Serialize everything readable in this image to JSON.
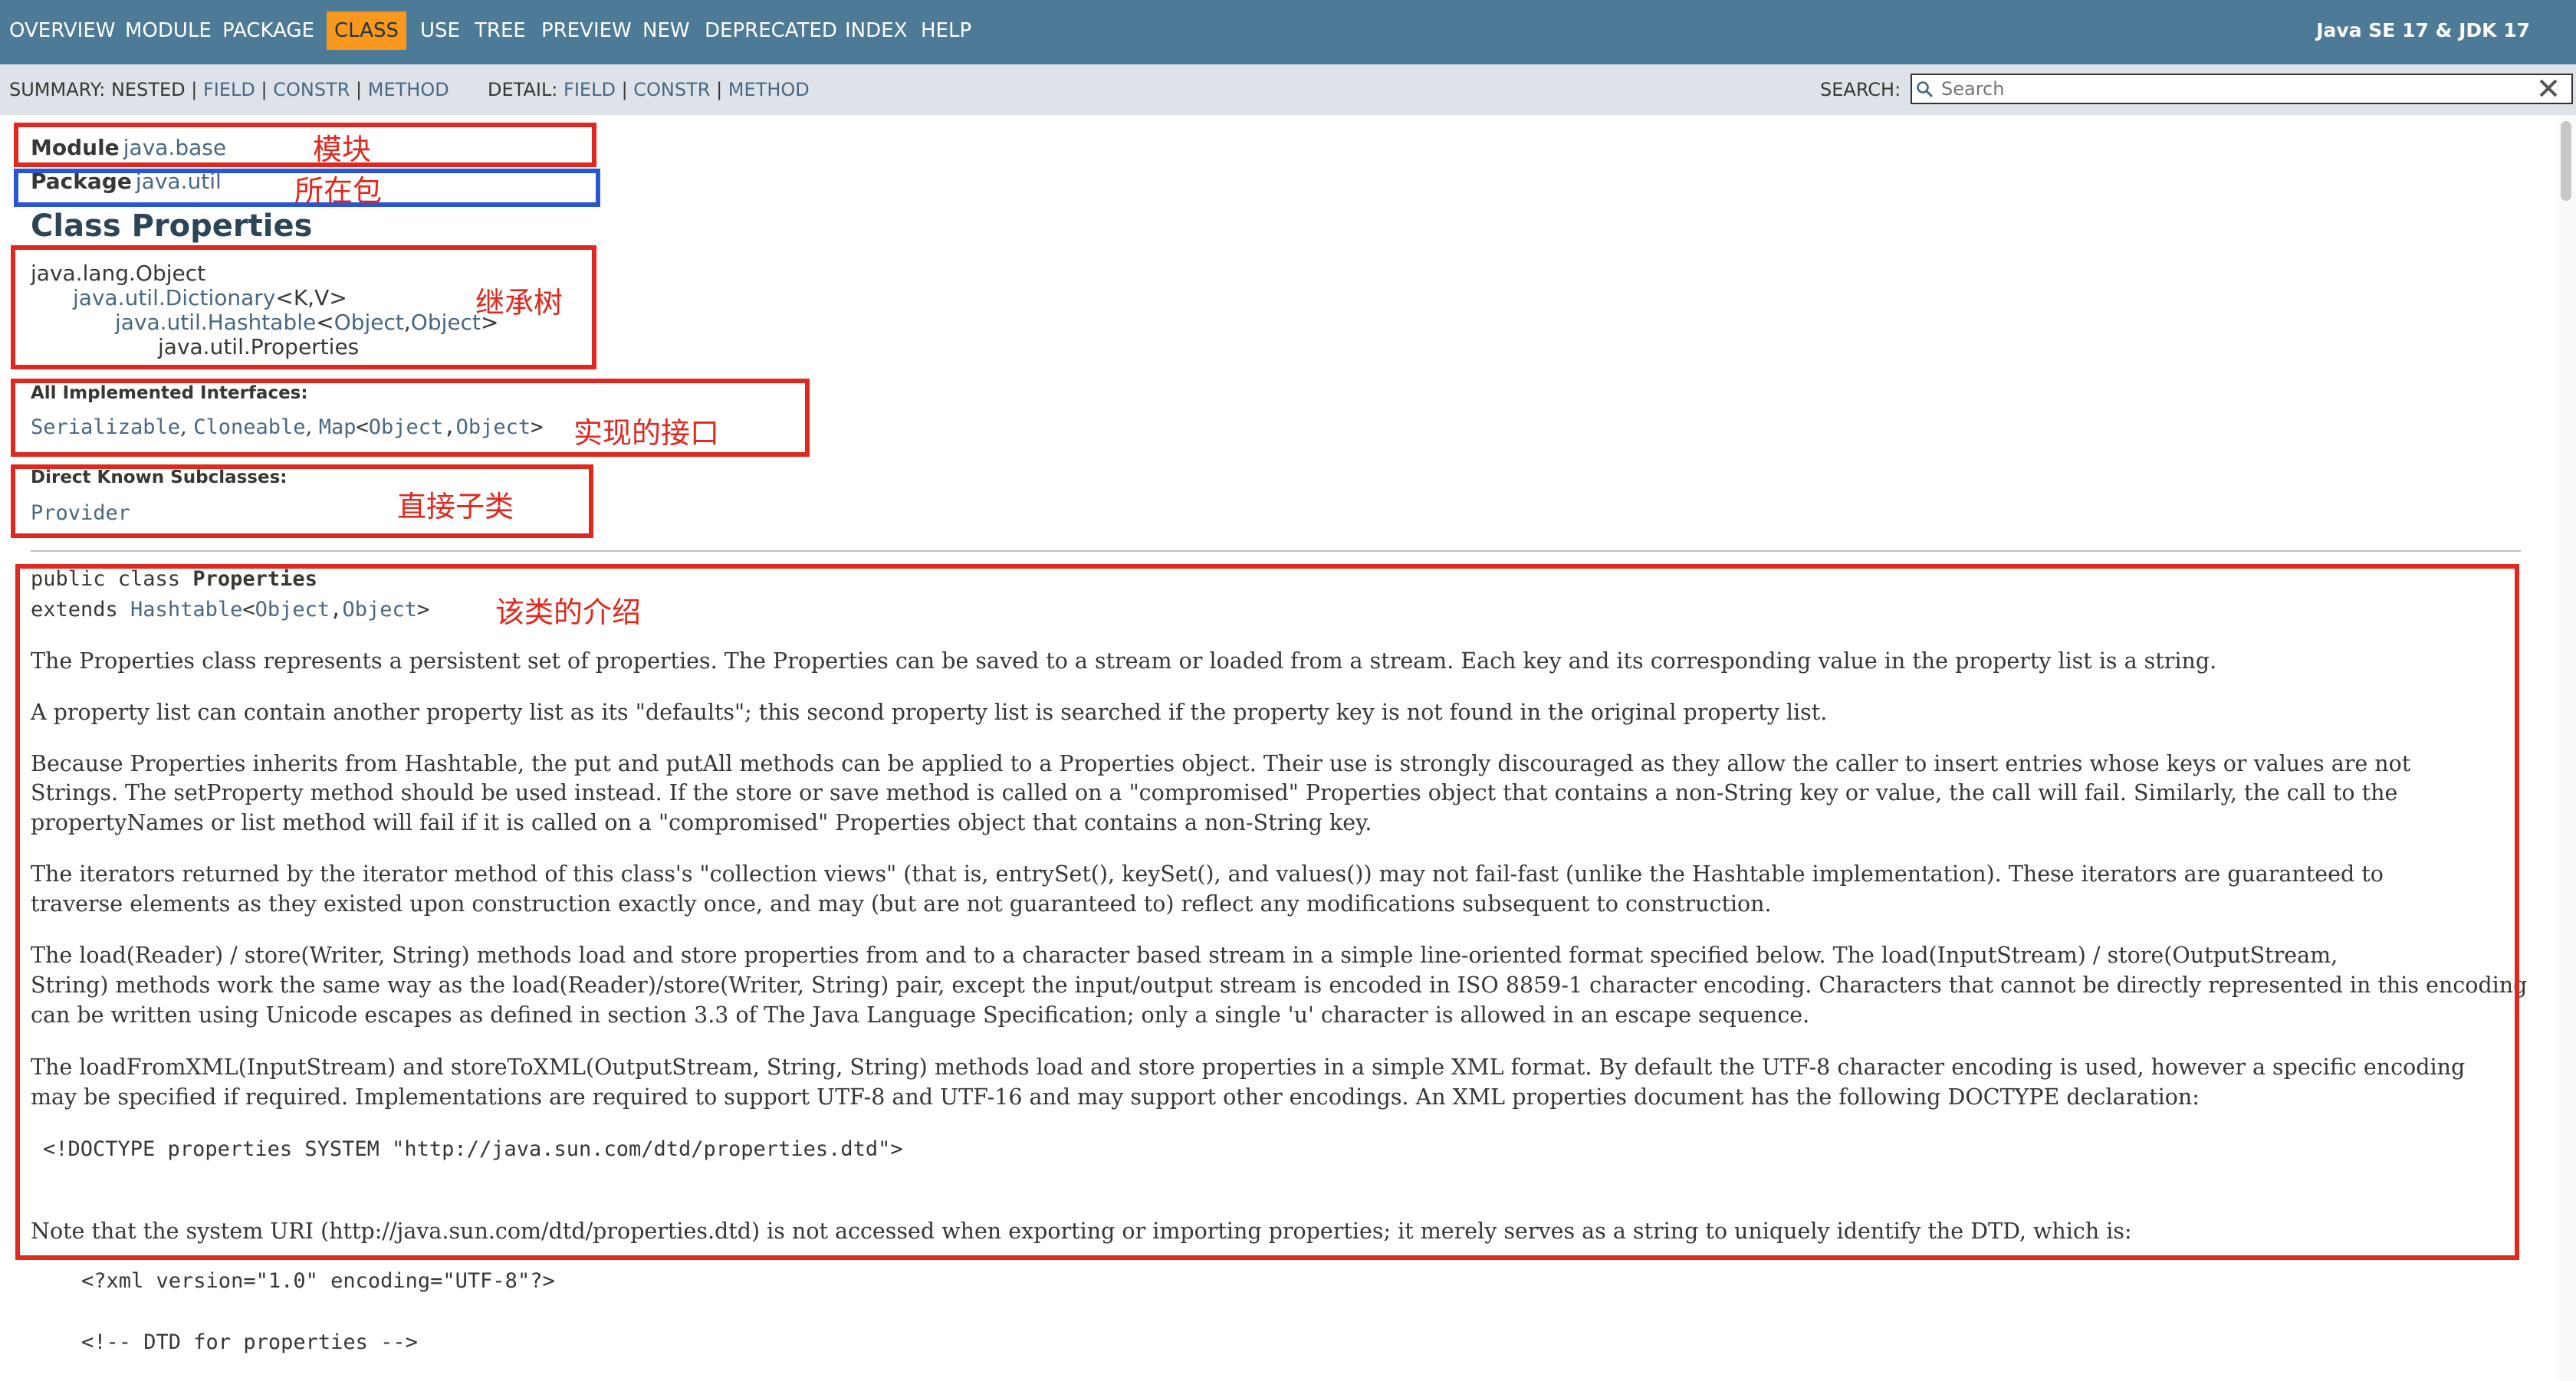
{
  "nav": {
    "items": [
      "OVERVIEW",
      "MODULE",
      "PACKAGE",
      "CLASS",
      "USE",
      "TREE",
      "PREVIEW",
      "NEW",
      "DEPRECATED",
      "INDEX",
      "HELP"
    ],
    "active": "CLASS",
    "brand": "Java SE 17 & JDK 17"
  },
  "subnav": {
    "summary_label": "SUMMARY: NESTED | ",
    "summary_field": "FIELD",
    "summary_constr": "CONSTR",
    "summary_method": "METHOD",
    "detail_label": "DETAIL: ",
    "detail_field": "FIELD",
    "detail_constr": "CONSTR",
    "detail_method": "METHOD",
    "sep": " | ",
    "search_label": "SEARCH:",
    "search_placeholder": "Search"
  },
  "header": {
    "module_label": "Module",
    "module_value": "java.base",
    "package_label": "Package",
    "package_value": "java.util",
    "title": "Class Properties"
  },
  "inheritance": [
    "java.lang.Object",
    "java.util.Dictionary",
    "<K,V>",
    "java.util.Hashtable",
    "<",
    "Object",
    ",",
    "Object",
    ">",
    "java.util.Properties"
  ],
  "interfaces": {
    "label": "All Implemented Interfaces:",
    "items": [
      "Serializable",
      "Cloneable",
      "Map",
      "Object",
      "Object"
    ]
  },
  "subclasses": {
    "label": "Direct Known Subclasses:",
    "items": [
      "Provider"
    ]
  },
  "signature": {
    "line1_prefix": "public class ",
    "line1_name": "Properties",
    "line2_prefix": "extends ",
    "line2_link": "Hashtable",
    "line2_type1": "Object",
    "line2_type2": "Object"
  },
  "annotations": {
    "module": "模块",
    "package": "所在包",
    "inheritance": "继承树",
    "interfaces": "实现的接口",
    "subclasses": "直接子类",
    "intro": "该类的介绍"
  },
  "desc": {
    "p1": "The Properties class represents a persistent set of properties. The Properties can be saved to a stream or loaded from a stream. Each key and its corresponding value in the property list is a string.",
    "p2": "A property list can contain another property list as its \"defaults\"; this second property list is searched if the property key is not found in the original property list.",
    "p3a": "Because Properties inherits from Hashtable, the put and putAll methods can be applied to a Properties object. Their use is strongly discouraged as they allow the caller to insert entries whose keys or values are not",
    "p3b": "Strings. The setProperty method should be used instead. If the store or save method is called on a \"compromised\" Properties object that contains a non-String key or value, the call will fail. Similarly, the call to the",
    "p3c": "propertyNames or list method will fail if it is called on a \"compromised\" Properties object that contains a non-String key.",
    "p4a": "The iterators returned by the iterator method of this class's \"collection views\" (that is, entrySet(), keySet(), and values()) may not fail-fast (unlike the Hashtable implementation). These iterators are guaranteed to",
    "p4b": "traverse elements as they existed upon construction exactly once, and may (but are not guaranteed to) reflect any modifications subsequent to construction.",
    "p5a": "The load(Reader) / store(Writer, String) methods load and store properties from and to a character based stream in a simple line-oriented format specified below. The load(InputStream) / store(OutputStream,",
    "p5b": "String) methods work the same way as the load(Reader)/store(Writer, String) pair, except the input/output stream is encoded in ISO 8859-1 character encoding. Characters that cannot be directly represented in this encoding",
    "p5c": "can be written using Unicode escapes as defined in section 3.3 of The Java Language Specification; only a single 'u' character is allowed in an escape sequence.",
    "p6a": "The loadFromXML(InputStream) and storeToXML(OutputStream, String, String) methods load and store properties in a simple XML format. By default the UTF-8 character encoding is used, however a specific encoding",
    "p6b": "may be specified if required. Implementations are required to support UTF-8 and UTF-16 and may support other encodings. An XML properties document has the following DOCTYPE declaration:",
    "doctype": "<!DOCTYPE properties SYSTEM \"http://java.sun.com/dtd/properties.dtd\">",
    "p7": "Note that the system URI (http://java.sun.com/dtd/properties.dtd) is not accessed when exporting or importing properties; it merely serves as a string to uniquely identify the DTD, which is:",
    "xml_decl": "<?xml version=\"1.0\" encoding=\"UTF-8\"?>",
    "dtd_comment": "<!-- DTD for properties -->"
  }
}
